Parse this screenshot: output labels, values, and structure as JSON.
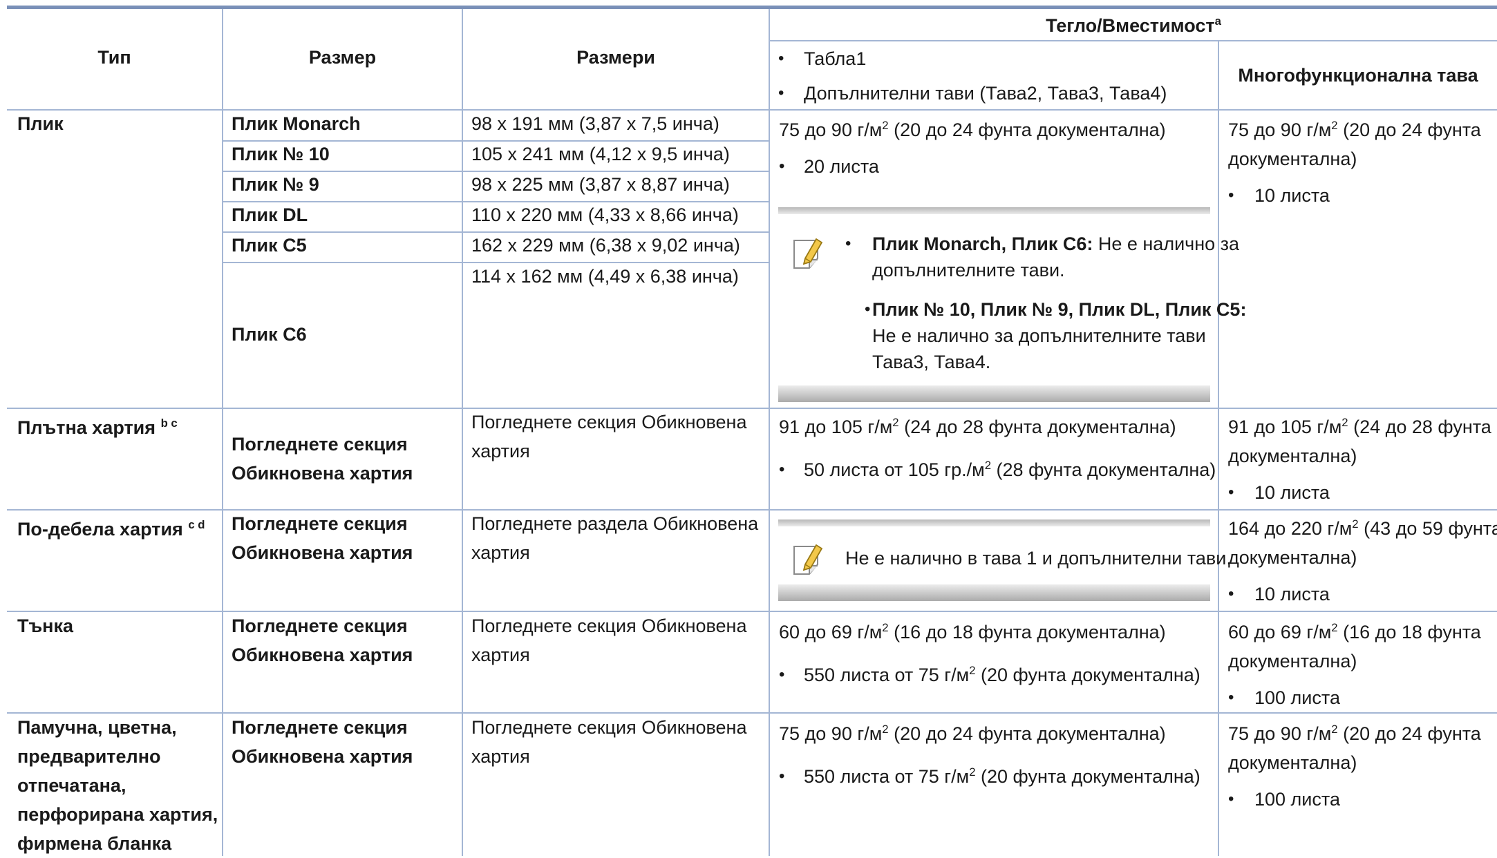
{
  "headers": {
    "type": "Тип",
    "size": "Размер",
    "dimensions": "Размери",
    "weight_capacity": "Тегло/Вместимост",
    "weight_capacity_sup": "a",
    "tray_bullet_1": "Табла1",
    "tray_bullet_2": "Допълнителни тави (Тава2, Тава3, Тава4)",
    "multipurpose": "Многофункционална тава"
  },
  "rows": {
    "envelope": {
      "type": "Плик",
      "sizes": [
        {
          "name": "Плик Monarch",
          "dim": "98 x 191 мм (3,87 x 7,5 инча)"
        },
        {
          "name": "Плик № 10",
          "dim": "105 x 241 мм (4,12 x 9,5 инча)"
        },
        {
          "name": "Плик № 9",
          "dim": "98 x 225 мм (3,87 x 8,87 инча)"
        },
        {
          "name": "Плик DL",
          "dim": "110 x 220 мм (4,33 x 8,66 инча)"
        },
        {
          "name": "Плик C5",
          "dim": "162 x 229 мм (6,38 x 9,02 инча)"
        },
        {
          "name": "Плик C6",
          "dim": "114 x 162 мм (4,49 x 6,38 инча)"
        }
      ],
      "tray_weight": "75 до 90 г/м",
      "tray_weight_rest": " (20 до 24 фунта документална)",
      "tray_capacity": "20 листа",
      "note1_bold": "Плик Monarch, Плик C6:",
      "note1_line1": " Не е налично за",
      "note1_line2": "допълнителните тави.",
      "note2_bold": "Плик № 10, Плик № 9, Плик DL, Плик C5:",
      "note2_line2": "Не е налично за допълнителните тави",
      "note2_line3": "Тава3, Тава4.",
      "mp_weight_l1": "75 до 90 г/м",
      "mp_weight_l1_rest": " (20 до 24 фунта",
      "mp_weight_l2": "документална)",
      "mp_capacity": "10 листа"
    },
    "heavy": {
      "type": "Плътна хартия",
      "type_sup": "b c",
      "size_l1": "Погледнете секция",
      "size_l2": "Обикновена хартия",
      "dim_l1": "Погледнете секция Обикновена",
      "dim_l2": "хартия",
      "tray_weight": "91 до 105 г/м",
      "tray_weight_rest": " (24 до 28 фунта документална)",
      "tray_capacity": "50 листа от 105 гр./м",
      "tray_capacity_rest": " (28 фунта документална)",
      "mp_weight_l1": "91 до 105 г/м",
      "mp_weight_l1_rest": " (24 до 28 фунта",
      "mp_weight_l2": "документална)",
      "mp_capacity": "10 листа"
    },
    "heavier": {
      "type": "По-дебела хартия",
      "type_sup": "c d",
      "size_l1": "Погледнете секция",
      "size_l2": "Обикновена хартия",
      "dim_l1": "Погледнете раздела Обикновена",
      "dim_l2": "хартия",
      "note": "Не е налично в тава 1 и допълнителни тави.",
      "mp_weight_l1": "164 до 220 г/м",
      "mp_weight_l1_rest": " (43 до 59 фунта",
      "mp_weight_l2": "документална)",
      "mp_capacity": "10 листа"
    },
    "thin": {
      "type": "Тънка",
      "size_l1": "Погледнете секция",
      "size_l2": "Обикновена хартия",
      "dim_l1": "Погледнете секция Обикновена",
      "dim_l2": "хартия",
      "tray_weight": "60 до 69 г/м",
      "tray_weight_rest": " (16 до 18 фунта документална)",
      "tray_capacity": "550 листа от 75 г/м",
      "tray_capacity_rest": " (20 фунта документална)",
      "mp_weight_l1": "60 до 69 г/м",
      "mp_weight_l1_rest": " (16 до 18 фунта",
      "mp_weight_l2": "документална)",
      "mp_capacity": "100 листа"
    },
    "cotton": {
      "type_lines": [
        "Памучна, цветна,",
        "предварително",
        "отпечатана,",
        "перфорирана хартия,",
        "фирмена бланка"
      ],
      "size_l1": "Погледнете секция",
      "size_l2": "Обикновена хартия",
      "dim_l1": "Погледнете секция Обикновена",
      "dim_l2": "хартия",
      "tray_weight": "75 до 90 г/м",
      "tray_weight_rest": " (20 до 24 фунта документална)",
      "tray_capacity": "550 листа от 75 г/м",
      "tray_capacity_rest": " (20 фунта документална)",
      "mp_weight_l1": "75 до 90 г/м",
      "mp_weight_l1_rest": " (20 до 24 фунта",
      "mp_weight_l2": "документална)",
      "mp_capacity": "100 листа"
    }
  },
  "superscript_2": "2",
  "bullet_char": "•",
  "icons": {
    "note": "note-pencil-icon"
  },
  "colors": {
    "rule": "#7a90b8",
    "grid": "#a4b6d4"
  }
}
